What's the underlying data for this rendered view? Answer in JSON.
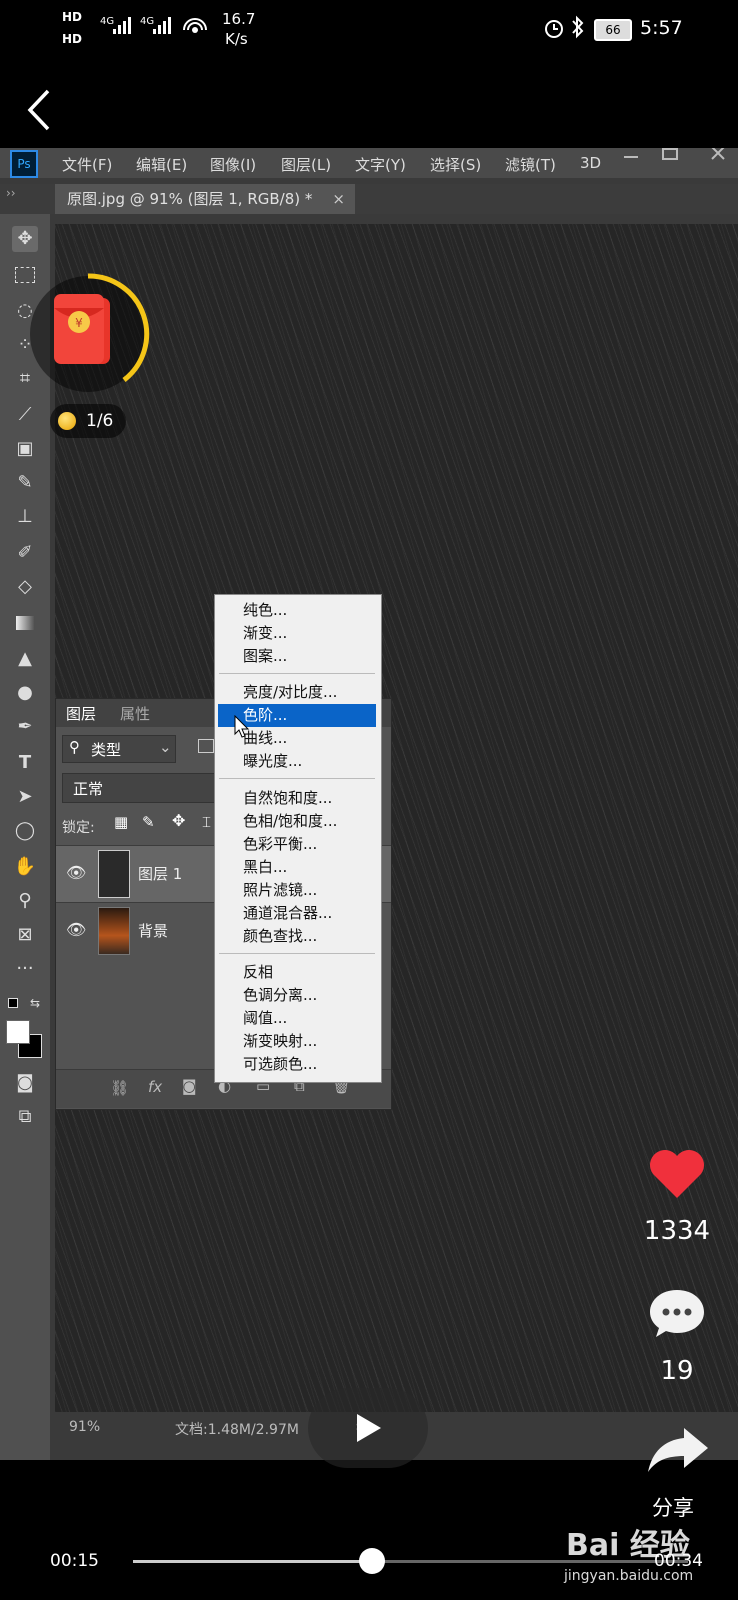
{
  "status_bar": {
    "hd1": "HD",
    "hd2": "HD",
    "net1": "4G",
    "net2": "4G",
    "speed_value": "16.7",
    "speed_unit": "K/s",
    "battery": "66",
    "time": "5:57"
  },
  "photoshop": {
    "app_icon": "Ps",
    "menus": [
      "文件(F)",
      "编辑(E)",
      "图像(I)",
      "图层(L)",
      "文字(Y)",
      "选择(S)",
      "滤镜(T)",
      "3D"
    ],
    "doc_tab": "原图.jpg @ 91% (图层 1, RGB/8) *",
    "tab_close": "×",
    "zoom": "91%",
    "doc_info": "文档:1.48M/2.97M",
    "layers_panel": {
      "tab_layers": "图层",
      "tab_properties": "属性",
      "filter_label": "类型",
      "blend_mode": "正常",
      "lock_label": "锁定:",
      "layers": [
        {
          "name": "图层 1"
        },
        {
          "name": "背景"
        }
      ]
    },
    "adjust_menu": {
      "groups": [
        [
          "纯色...",
          "渐变...",
          "图案..."
        ],
        [
          "亮度/对比度...",
          "色阶...",
          "曲线...",
          "曝光度..."
        ],
        [
          "自然饱和度...",
          "色相/饱和度...",
          "色彩平衡...",
          "黑白...",
          "照片滤镜...",
          "通道混合器...",
          "颜色查找..."
        ],
        [
          "反相",
          "色调分离...",
          "阈值...",
          "渐变映射...",
          "可选颜色..."
        ]
      ],
      "selected": "色阶..."
    }
  },
  "overlay": {
    "coin_progress": "1/6",
    "likes": "1334",
    "comments": "19",
    "share_label": "分享",
    "current_time": "00:15",
    "total_time": "00:34",
    "playback_progress": 0.43,
    "watermark_logo": "Bai 经验",
    "watermark_url": "jingyan.baidu.com"
  },
  "colors": {
    "like_red": "#f0303c",
    "menu_highlight": "#0a64c8",
    "coin_ring": "#f5c518"
  }
}
